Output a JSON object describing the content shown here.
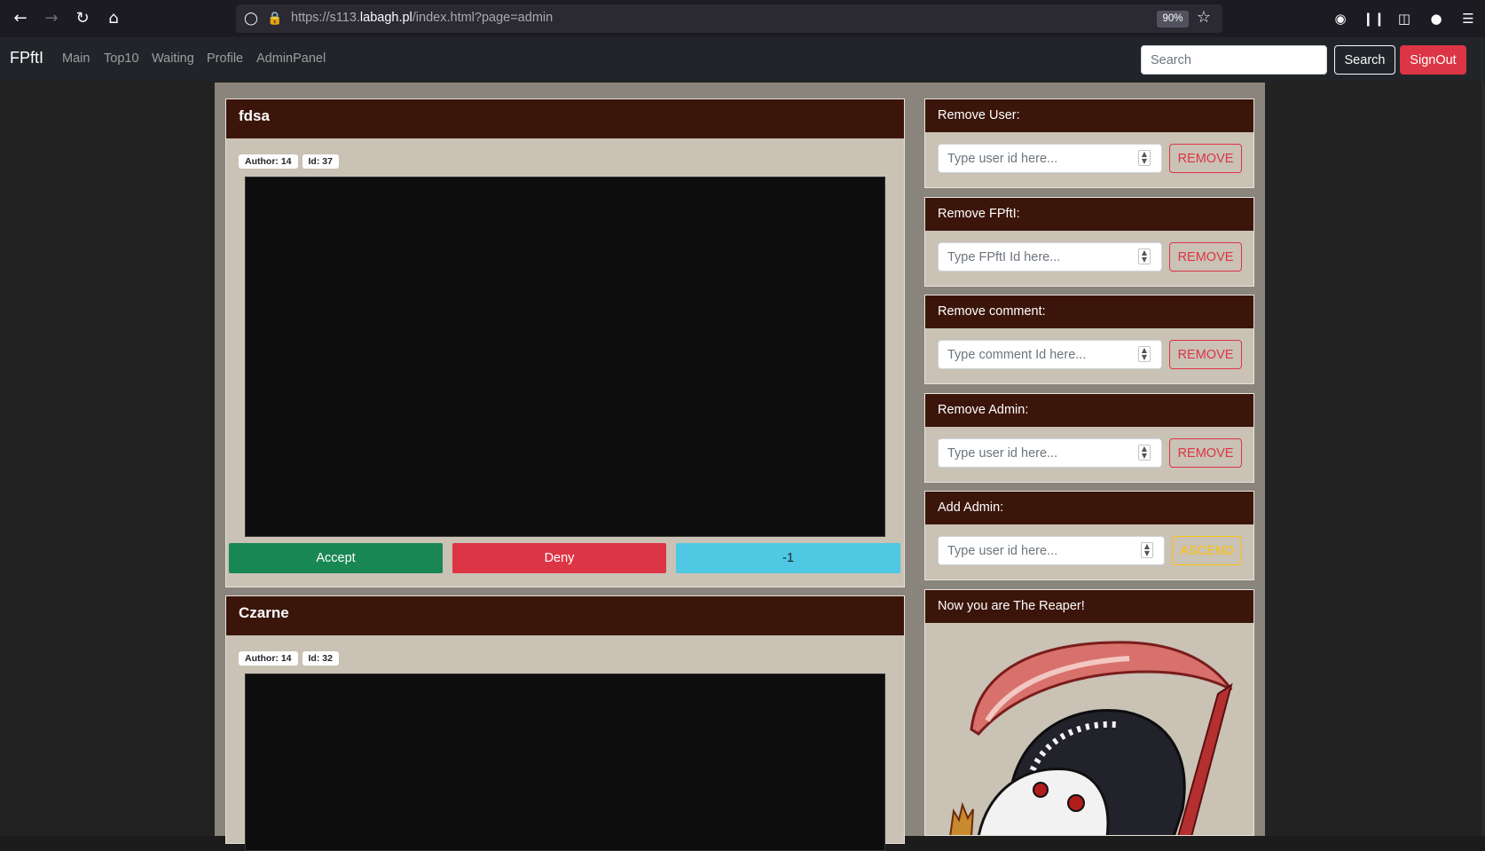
{
  "browser": {
    "url_prefix": "https://s113.",
    "url_host": "labagh.pl",
    "url_path": "/index.html?page=admin",
    "zoom": "90%"
  },
  "nav": {
    "brand": "FPftI",
    "links": [
      "Main",
      "Top10",
      "Waiting",
      "Profile",
      "AdminPanel"
    ],
    "search_placeholder": "Search",
    "search_label": "Search",
    "signout_label": "SignOut"
  },
  "posts": [
    {
      "title": "fdsa",
      "author": "Author: 14",
      "id": "Id: 37",
      "accept": "Accept",
      "deny": "Deny",
      "score": "-1"
    },
    {
      "title": "Czarne",
      "author": "Author: 14",
      "id": "Id: 32"
    }
  ],
  "admin": {
    "remove_user": {
      "title": "Remove User:",
      "placeholder": "Type user id here...",
      "button": "REMOVE"
    },
    "remove_fpfti": {
      "title": "Remove FPftI:",
      "placeholder": "Type FPftI Id here...",
      "button": "REMOVE"
    },
    "remove_comment": {
      "title": "Remove comment:",
      "placeholder": "Type comment Id here...",
      "button": "REMOVE"
    },
    "remove_admin": {
      "title": "Remove Admin:",
      "placeholder": "Type user id here...",
      "button": "REMOVE"
    },
    "add_admin": {
      "title": "Add Admin:",
      "placeholder": "Type user id here...",
      "button": "ASCEND"
    },
    "reaper_title": "Now you are The Reaper!"
  },
  "colors": {
    "header_brown": "#3b150a",
    "card_bg": "#c9c2b5",
    "danger": "#dc3545",
    "success": "#198754",
    "info": "#4ec8e3",
    "warning": "#ffc107"
  }
}
